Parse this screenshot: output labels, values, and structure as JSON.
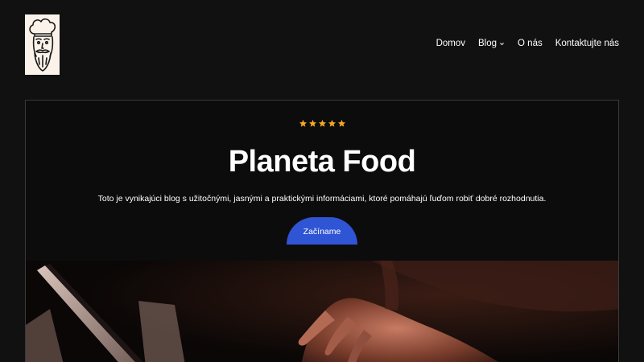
{
  "header": {
    "logo_icon": "chef-logo-icon",
    "nav": [
      {
        "label": "Domov"
      },
      {
        "label": "Blog",
        "has_dropdown": true
      },
      {
        "label": "O nás"
      },
      {
        "label": "Kontaktujte nás"
      }
    ]
  },
  "hero": {
    "rating": 5,
    "star_color": "#f5a623",
    "title": "Planeta Food",
    "subtitle": "Toto je vynikajúci blog s užitočnými, jasnými a praktickými informáciami, ktoré pomáhajú ľuďom robiť dobré rozhodnutia.",
    "cta_label": "Začíname",
    "cta_color": "#2f55d4"
  }
}
